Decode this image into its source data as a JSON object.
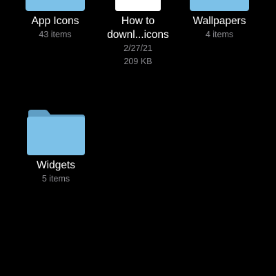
{
  "items": [
    {
      "name": "App Icons",
      "meta": [
        "43 items"
      ],
      "icon": "folder-icon"
    },
    {
      "name_lines": [
        "How to",
        "downl...icons"
      ],
      "meta": [
        "2/27/21",
        "209 KB"
      ],
      "icon": "document-icon"
    },
    {
      "name": "Wallpapers",
      "meta": [
        "4 items"
      ],
      "icon": "folder-icon"
    },
    {
      "name": "Widgets",
      "meta": [
        "5 items"
      ],
      "icon": "folder-icon"
    }
  ],
  "colors": {
    "background": "#000000",
    "folder_front": "#7cc1e8",
    "folder_back": "#5f9ec4",
    "text_primary": "#ffffff",
    "text_secondary": "#8e8e93"
  }
}
